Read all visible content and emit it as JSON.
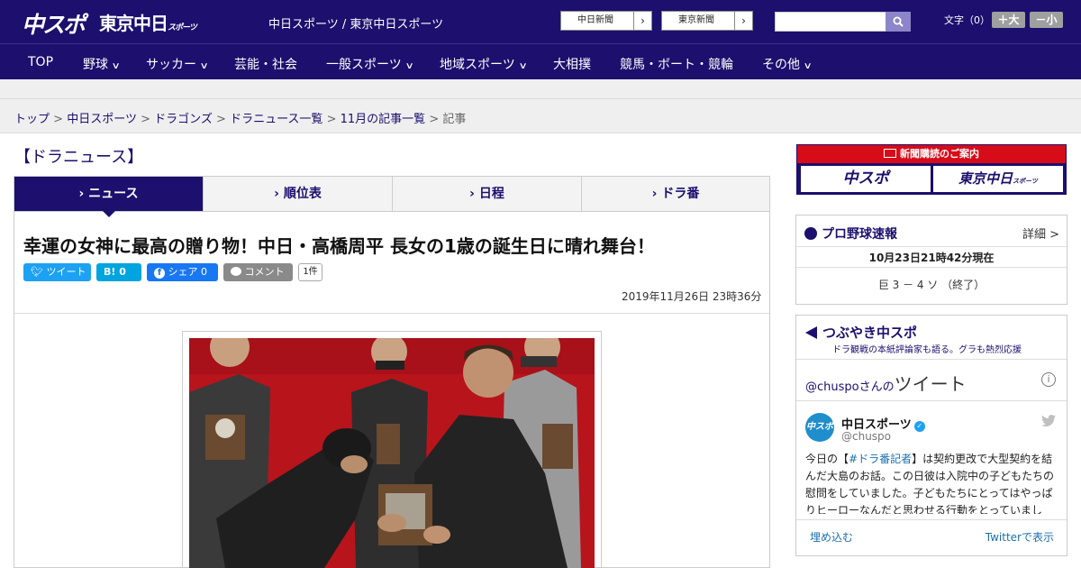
{
  "header": {
    "logo_main": "中スポ",
    "logo_tokyo": "東京中日",
    "logo_tokyo_small": "スポーツ",
    "site_title": "中日スポーツ / 東京中日スポーツ",
    "paper_links": [
      "中日新聞",
      "東京新聞"
    ],
    "font_size_label": "文字（0）",
    "font_larger": "＋大",
    "font_smaller": "－小",
    "search_placeholder": ""
  },
  "nav": {
    "items": [
      {
        "label": "TOP",
        "has_menu": false
      },
      {
        "label": "野球",
        "has_menu": true
      },
      {
        "label": "サッカー",
        "has_menu": true
      },
      {
        "label": "芸能・社会",
        "has_menu": false
      },
      {
        "label": "一般スポーツ",
        "has_menu": true
      },
      {
        "label": "地域スポーツ",
        "has_menu": true
      },
      {
        "label": "大相撲",
        "has_menu": false
      },
      {
        "label": "競馬・ボート・競輪",
        "has_menu": false
      },
      {
        "label": "その他",
        "has_menu": true
      }
    ]
  },
  "breadcrumb": {
    "items": [
      "トップ",
      "中日スポーツ",
      "ドラゴンズ",
      "ドラニュース一覧",
      "11月の記事一覧"
    ],
    "current": "記事",
    "separator": ">"
  },
  "section": {
    "title": "【ドラニュース】"
  },
  "tabs": {
    "items": [
      {
        "label": "ニュース",
        "active": true
      },
      {
        "label": "順位表",
        "active": false
      },
      {
        "label": "日程",
        "active": false
      },
      {
        "label": "ドラ番",
        "active": false
      }
    ]
  },
  "article": {
    "headline": "幸運の女神に最高の贈り物！中日・高橋周平 長女の1歳の誕生日に晴れ舞台！",
    "share": {
      "tweet": "ツイート",
      "hatena_label": "B!",
      "hatena_count": "0",
      "facebook": "シェア",
      "facebook_count": "0",
      "comment": "コメント",
      "comment_count": "1件"
    },
    "date": "2019年11月26日 23時36分"
  },
  "sidebar": {
    "ad": {
      "banner": "新聞購読のご案内",
      "logo_left": "中スポ",
      "logo_right": "東京中日",
      "logo_right_small": "スポーツ"
    },
    "baseball": {
      "title": "プロ野球速報",
      "detail": "詳細 >",
      "updated": "10月23日21時42分現在",
      "score": "巨 3 － 4 ソ （終了）"
    },
    "twitter": {
      "title": "つぶやき中スポ",
      "subtitle": "ドラ観戦の本紙評論家も語る。グラも熱烈応援",
      "handle": "@chuspo",
      "handle_suffix": "さんの",
      "handle_big": "ツイート",
      "author_name": "中日スポーツ",
      "author_user": "@chuspo",
      "avatar_text": "中スポ",
      "text_pre": "今日の【",
      "tag": "#ドラ番記者",
      "text_post": "】は契約更改で大型契約を結んだ大島のお話。この日彼は入院中の子どもたちの慰問をしていました。子どもたちにとってはやっぱりヒーローなんだと思わせる行動をとっていまし",
      "embed": "埋め込む",
      "view_on": "Twitterで表示"
    }
  },
  "colors": {
    "brand_navy": "#1c0f6e",
    "twitter_blue": "#1da1f2",
    "hatena_blue": "#00a4de",
    "facebook_blue": "#1877f2",
    "comment_gray": "#8a8a8a",
    "ad_red": "#d70c19",
    "photo_backdrop": "#b8141c"
  }
}
